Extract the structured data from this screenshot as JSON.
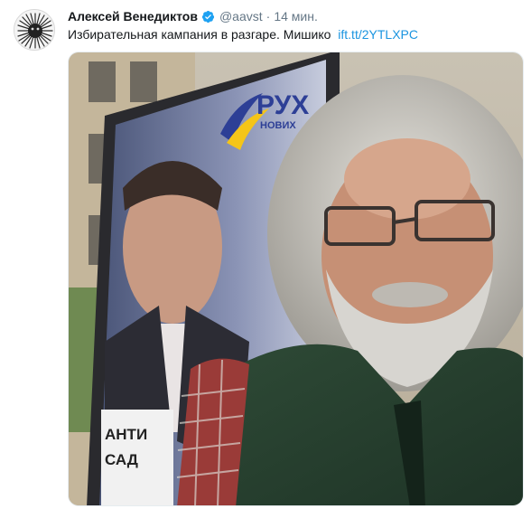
{
  "tweet": {
    "author_name": "Алексей Венедиктов",
    "verified_icon": "verified-badge-icon",
    "handle": "@aavst",
    "separator": "·",
    "time": "14 мин.",
    "text": "Избирательная кампания в разгаре. Мишико",
    "link": "ift.tt/2YTLXPC"
  },
  "media": {
    "billboard_brand": "РУХ",
    "billboard_subtitle": "НОВИХ",
    "billboard_bottom_line1": "АНТИ",
    "billboard_bottom_line2": "САД"
  },
  "colors": {
    "link": "#1b95e0",
    "verified": "#1da1f2",
    "secondary_text": "#657786"
  }
}
